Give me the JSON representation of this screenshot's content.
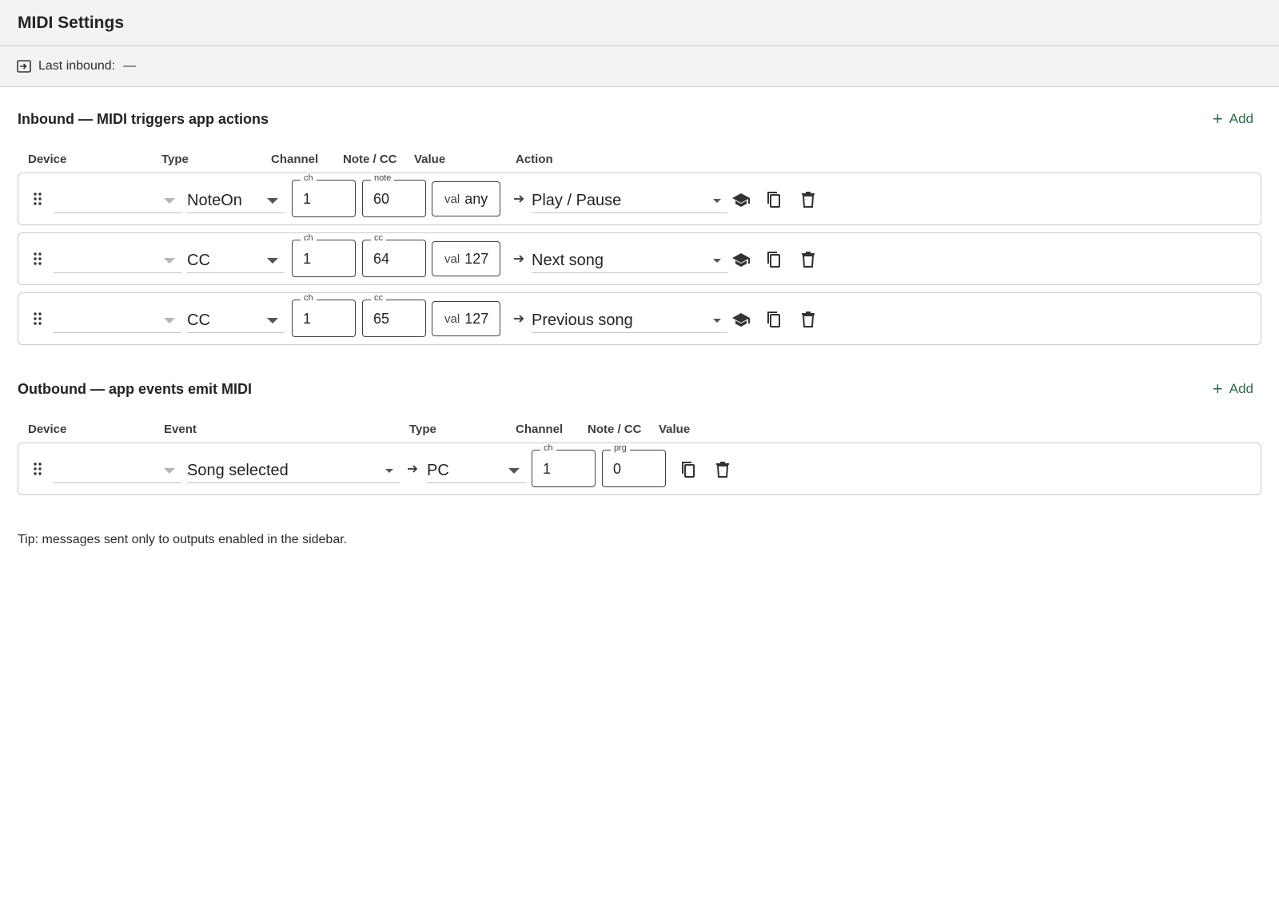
{
  "header": {
    "title": "MIDI Settings"
  },
  "inbound_status": {
    "label": "Last inbound:",
    "value": "—"
  },
  "inbound": {
    "title": "Inbound — MIDI triggers app actions",
    "add_label": "Add",
    "columns": {
      "device": "Device",
      "type": "Type",
      "channel": "Channel",
      "note_cc": "Note / CC",
      "value": "Value",
      "action": "Action"
    },
    "rows": [
      {
        "device": "",
        "type": "NoteOn",
        "ch_label": "ch",
        "ch": "1",
        "num_label": "note",
        "num": "60",
        "val_label": "val",
        "val": "any",
        "action": "Play / Pause"
      },
      {
        "device": "",
        "type": "CC",
        "ch_label": "ch",
        "ch": "1",
        "num_label": "cc",
        "num": "64",
        "val_label": "val",
        "val": "127",
        "action": "Next song"
      },
      {
        "device": "",
        "type": "CC",
        "ch_label": "ch",
        "ch": "1",
        "num_label": "cc",
        "num": "65",
        "val_label": "val",
        "val": "127",
        "action": "Previous song"
      }
    ]
  },
  "outbound": {
    "title": "Outbound — app events emit MIDI",
    "add_label": "Add",
    "columns": {
      "device": "Device",
      "event": "Event",
      "type": "Type",
      "channel": "Channel",
      "note_cc": "Note / CC",
      "value": "Value"
    },
    "rows": [
      {
        "device": "",
        "event": "Song selected",
        "type": "PC",
        "ch_label": "ch",
        "ch": "1",
        "num_label": "prg",
        "num": "0"
      }
    ]
  },
  "tip": "Tip: messages sent only to outputs enabled in the sidebar.",
  "icons": {
    "inbound": "login-icon",
    "drag": "drag-handle-icon",
    "learn": "school-icon",
    "copy": "copy-icon",
    "delete": "trash-icon",
    "arrow": "arrow-right-icon",
    "add": "plus-icon"
  },
  "colors": {
    "accent": "#2e6b43",
    "header_bg": "#f3f4f2",
    "border": "#c8cbc7"
  }
}
